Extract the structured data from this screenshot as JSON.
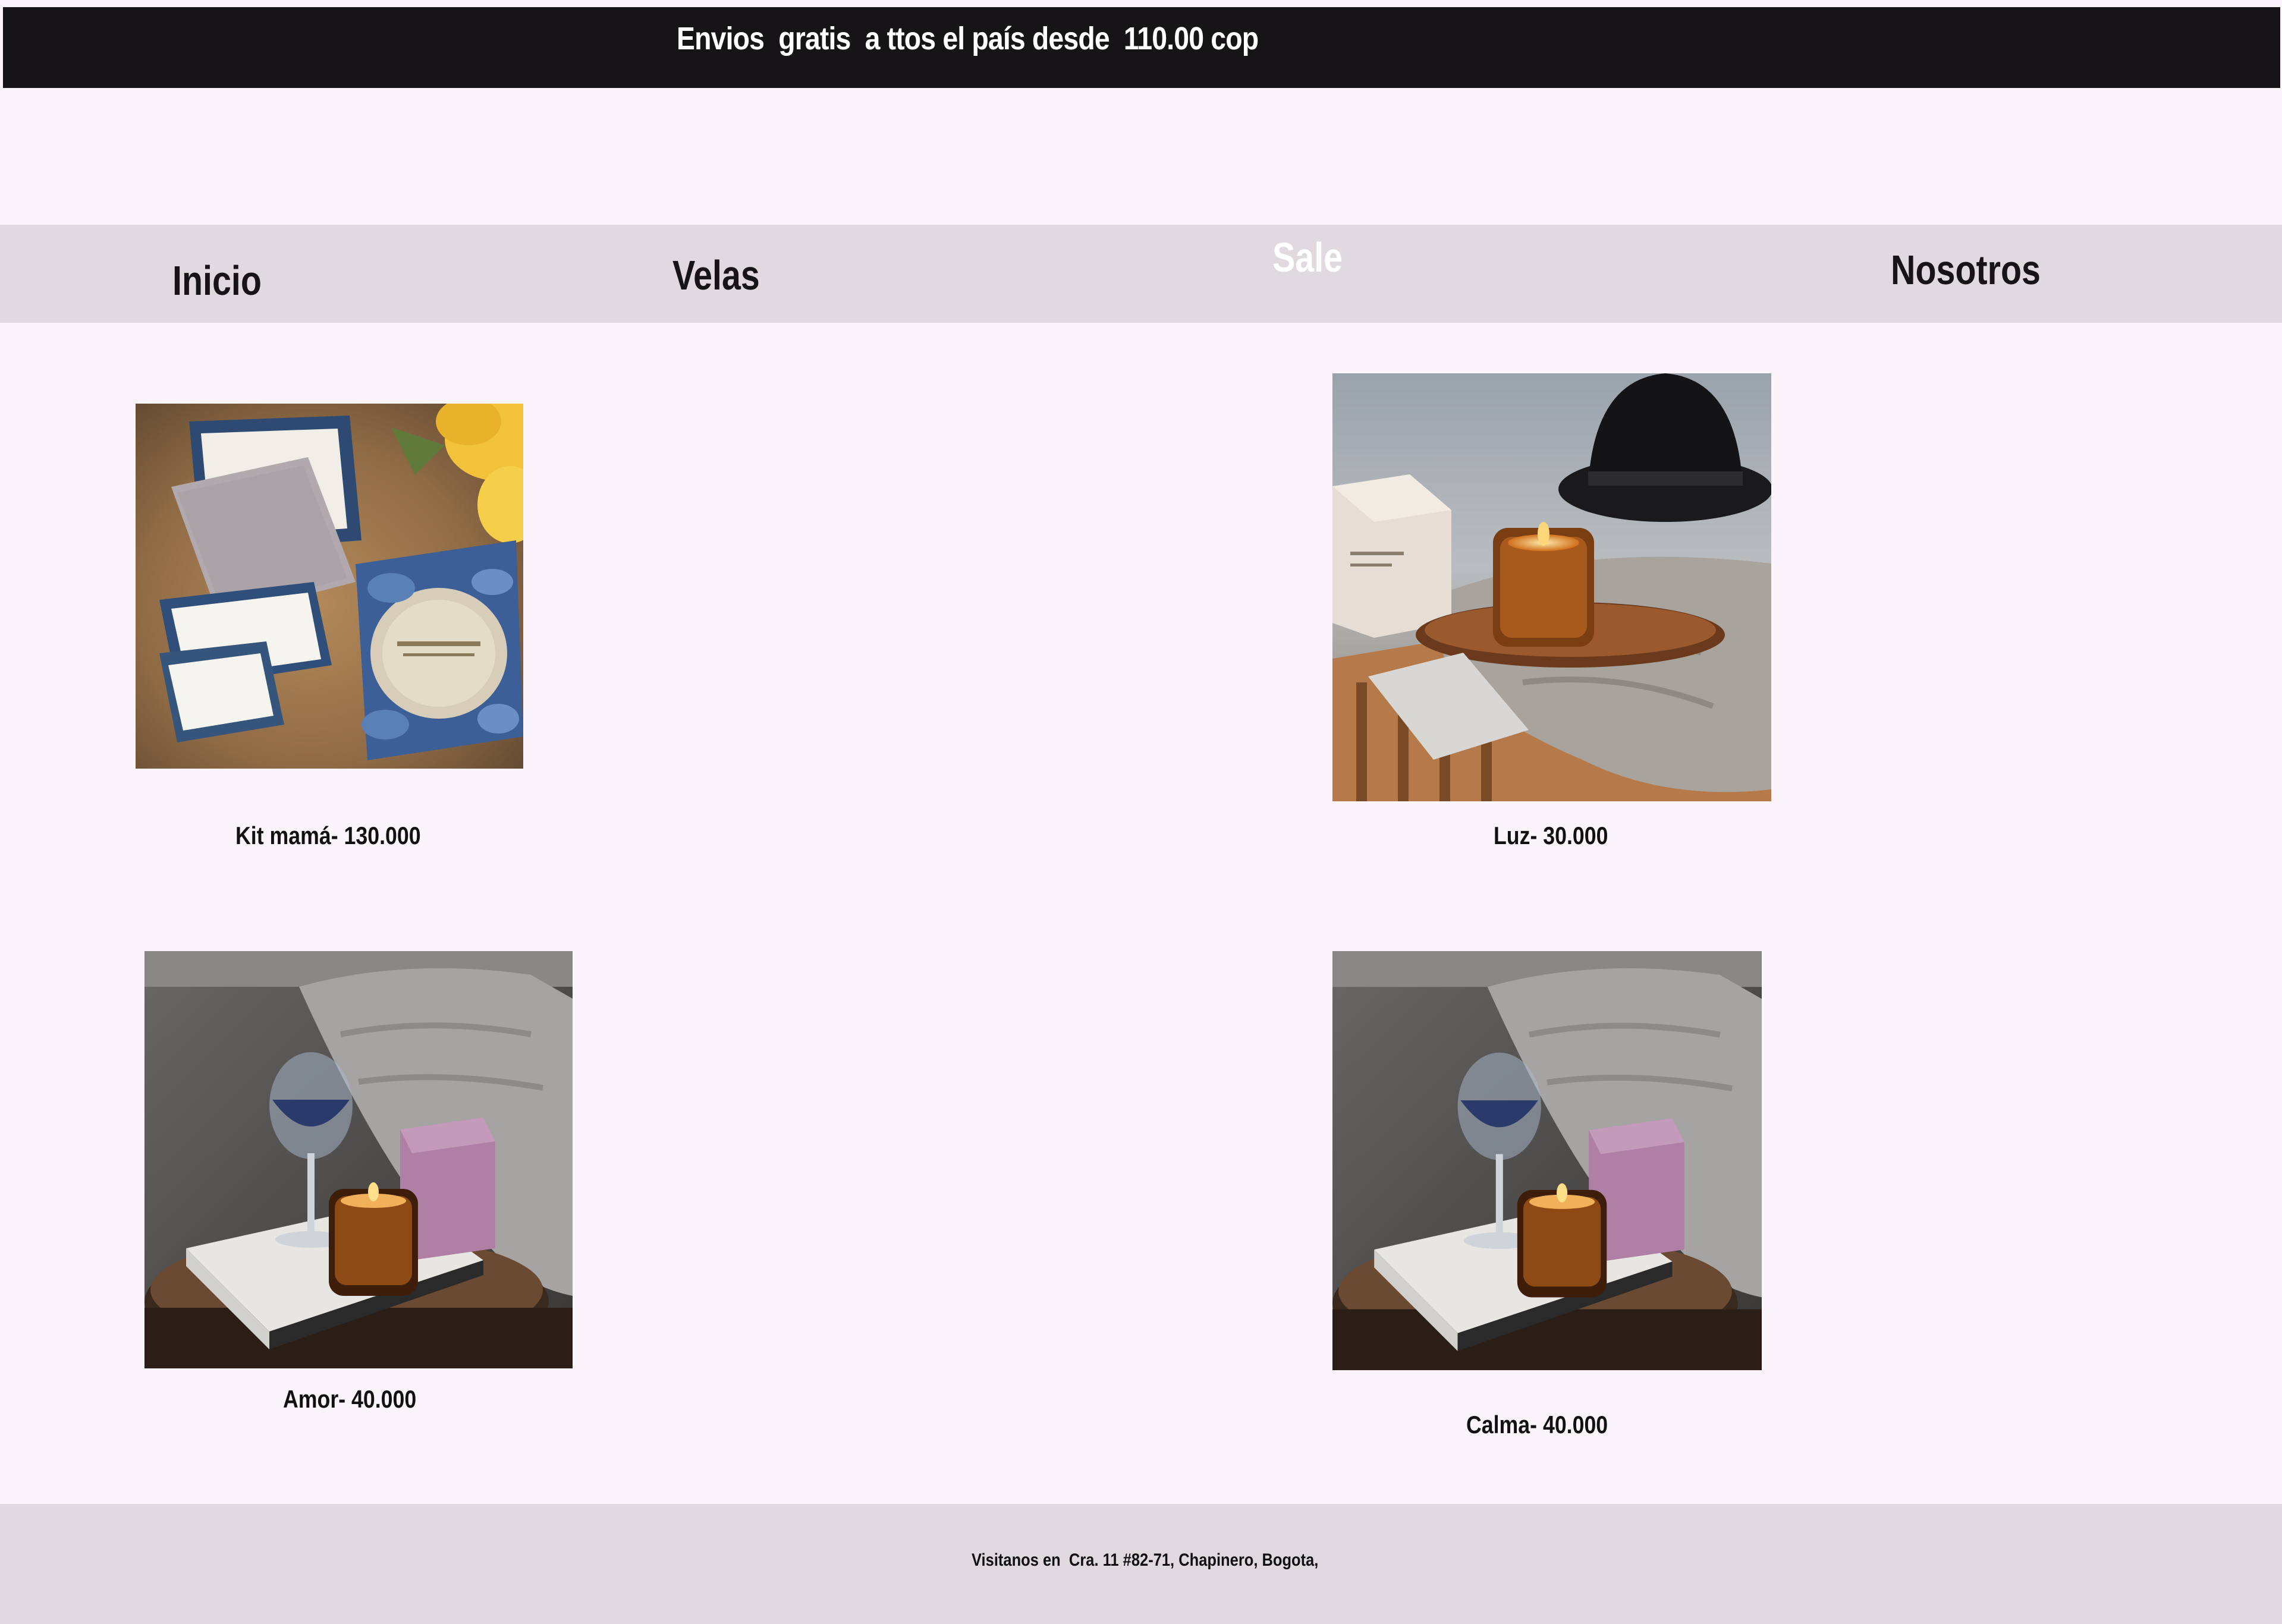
{
  "announcement": {
    "text": "Envios  gratis  a ttos el país desde  110.00 cop"
  },
  "nav": {
    "items": [
      {
        "label": "Inicio"
      },
      {
        "label": "Velas"
      },
      {
        "label": "Sale"
      },
      {
        "label": "Nosotros"
      }
    ]
  },
  "products": [
    {
      "label": "Kit mamá- 130.000",
      "image": "gift-kit-photo"
    },
    {
      "label": "Luz- 30.000",
      "image": "candle-with-hat-photo"
    },
    {
      "label": "Amor- 40.000",
      "image": "candle-with-wine-photo"
    },
    {
      "label": "Calma- 40.000",
      "image": "candle-with-wine-photo"
    }
  ],
  "footer": {
    "text": "Visitanos en  Cra. 11 #82-71, Chapinero, Bogota,"
  },
  "colors": {
    "page_bg": "#fbf4fa",
    "topbar_bg": "#161417",
    "navbar_bg": "#e0d9e0",
    "sale_text": "#ffffff"
  }
}
